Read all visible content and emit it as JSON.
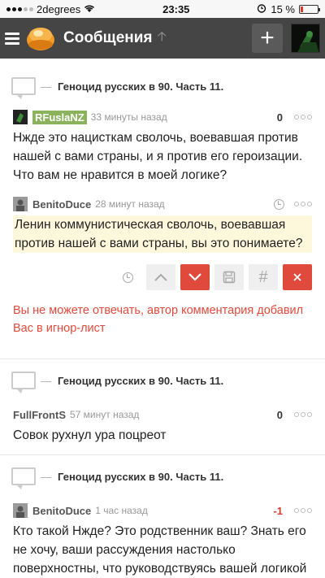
{
  "status": {
    "carrier": "2degrees",
    "time": "23:35",
    "battery": "15 %",
    "battery_level": 0.15
  },
  "appbar": {
    "title": "Сообщения"
  },
  "blocks": [
    {
      "post_title": "Геноцид русских в 90. Часть 11."
    },
    {
      "post_title": "Геноцид русских в 90. Часть 11."
    },
    {
      "post_title": "Геноцид русских в 90. Часть 11."
    }
  ],
  "comments": [
    {
      "author": "RFuslaNZ",
      "time": "33 минуты назад",
      "score": "0",
      "text": "Нжде это нацисткам сволочь, воевавшая против нашей с вами страны, и я против его героизации. Что вам не нравится в моей логике?"
    },
    {
      "author": "BenitoDuce",
      "time": "28 минут назад",
      "text": "Ленин коммунистическая сволочь, воевавшая против нашей с вами страны, вы это понимаете?"
    },
    {
      "author": "FullFrontS",
      "time": "57 минут назад",
      "score": "0",
      "text": "Совок рухнул ура поцреот"
    },
    {
      "author": "BenitoDuce",
      "time": "1 час назад",
      "score": "-1",
      "text": "Кто такой Нжде? Это родственник ваш? Знать его не хочу, ваши рассуждения настолько поверхностны, что руководствуясь вашей логикой предателем можно назвать любого."
    }
  ],
  "reply_warning": "Вы не можете отвечать, автор комментария добавил Вас в игнор-лист",
  "icons": {
    "up": "chevron-up-icon",
    "down": "chevron-down-icon",
    "save": "save-icon",
    "hash": "hash-icon",
    "close": "close-icon"
  }
}
